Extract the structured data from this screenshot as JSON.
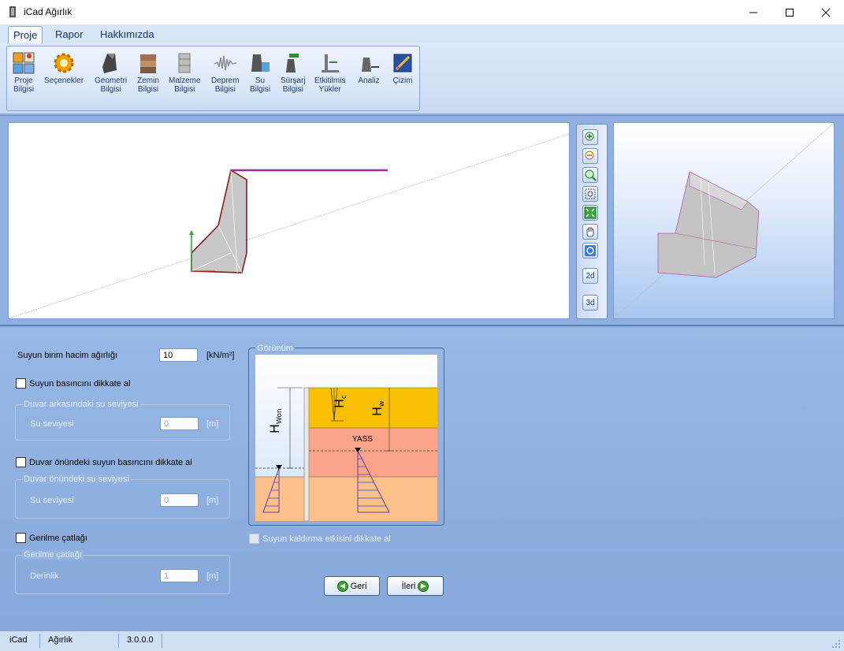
{
  "window": {
    "title": "iCad Ağırlık"
  },
  "menu": {
    "tabs": [
      {
        "label": "Proje"
      },
      {
        "label": "Rapor"
      },
      {
        "label": "Hakkımızda"
      }
    ]
  },
  "ribbon": {
    "items": [
      {
        "label": "Proje\nBilgisi"
      },
      {
        "label": "Seçenekler"
      },
      {
        "label": "Geometri\nBilgisi"
      },
      {
        "label": "Zemin\nBilgisi"
      },
      {
        "label": "Malzeme\nBilgisi"
      },
      {
        "label": "Deprem\nBilgisi"
      },
      {
        "label": "Su\nBilgisi"
      },
      {
        "label": "Sürşarj\nBilgisi"
      },
      {
        "label": "Etkitilmis\nYükler"
      },
      {
        "label": "Analiz"
      },
      {
        "label": "Çizim"
      }
    ]
  },
  "view_toolbar": {
    "btn_2d": "2d",
    "btn_3d": "3d"
  },
  "form": {
    "unit_weight_label": "Suyun birim hacim ağırlığı",
    "unit_weight_value": "10",
    "unit_weight_unit": "[kN/m²]",
    "water_pressure_check": "Suyun basıncını dikkate al",
    "behind_group": "Duvar arkasındaki su seviyesi",
    "behind_level_label": "Su seviyesi",
    "behind_level_value": "0",
    "behind_level_unit": "[m]",
    "front_pressure_check": "Duvar önündeki suyun basıncını dikkate al",
    "front_group": "Duvar önündeki su seviyesi",
    "front_level_label": "Su seviyesi",
    "front_level_value": "0",
    "front_level_unit": "[m]",
    "crack_check": "Gerilme çatlağı",
    "crack_group": "Gerilme çatlağı",
    "crack_depth_label": "Derinlik",
    "crack_depth_value": "1",
    "crack_depth_unit": "[m]",
    "view_group": "Görünüm",
    "uplift_check": "Suyun kaldırma etkisini dikkate al"
  },
  "diagram": {
    "label_hwon_main": "H",
    "label_hwon_sub": "Won",
    "label_hc_main": "H",
    "label_hc_sub": "c",
    "label_hw_main": "H",
    "label_hw_sub": "w",
    "label_yass": "YASS"
  },
  "nav": {
    "back": "Geri",
    "next": "İleri"
  },
  "status": {
    "app": "iCad",
    "module": "Ağırlık",
    "version": "3.0.0.0"
  },
  "colors": {
    "accent": "#8fb0e0",
    "wall_outline": "#8b1a1a",
    "surcharge": "#9c2a9c",
    "soil_top": "#f8c000",
    "soil_mid": "#fba48a",
    "soil_bottom": "#fcc08a"
  }
}
